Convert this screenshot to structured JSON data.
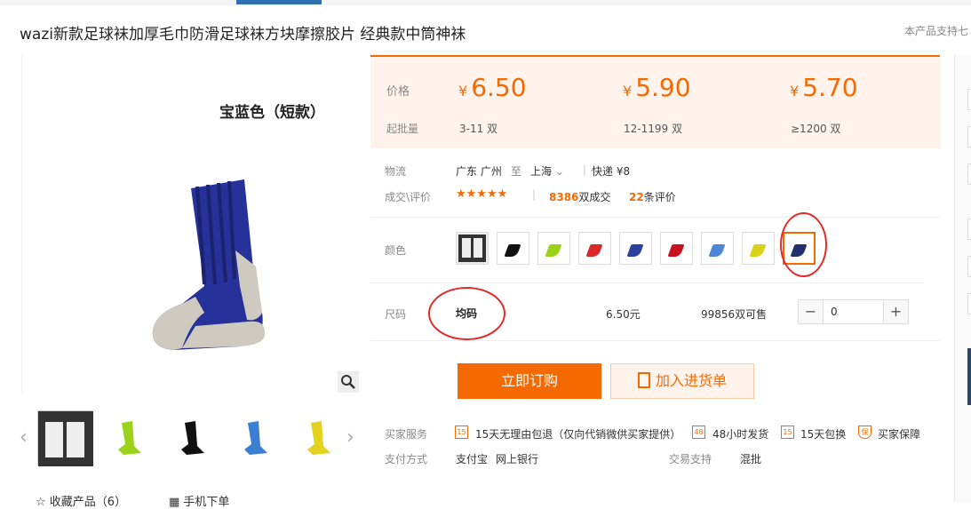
{
  "header": {
    "title": "wazi新款足球袜加厚毛巾防滑足球袜方块摩擦胶片 经典款中筒神袜",
    "support_text": "本产品支持七"
  },
  "gallery": {
    "image_label": "宝蓝色（短款）",
    "prev_icon": "chevron-left-icon",
    "next_icon": "chevron-right-icon",
    "zoom_icon": "magnifier-icon",
    "thumbnails": [
      {
        "colors": [
          "#ffffff",
          "#111111"
        ]
      },
      {
        "colors": [
          "#9bd21a",
          "#e8e8e8"
        ]
      },
      {
        "colors": [
          "#111111",
          "#e8e8e8"
        ]
      },
      {
        "colors": [
          "#3c7fd0",
          "#e8e8e8"
        ]
      },
      {
        "colors": [
          "#e3d21e",
          "#e8e8e8"
        ]
      }
    ],
    "favorite_label": "收藏产品（6）",
    "mobile_label": "手机下单"
  },
  "pricing": {
    "price_label": "价格",
    "batch_label": "起批量",
    "currency": "¥",
    "tiers": [
      {
        "price": "6.50",
        "range": "3-11 双"
      },
      {
        "price": "5.90",
        "range": "12-1199 双"
      },
      {
        "price": "5.70",
        "range": "≥1200 双"
      }
    ]
  },
  "logistics": {
    "label": "物流",
    "from": "广东 广州",
    "to_word": "至",
    "to": "上海",
    "shipping": "快递 ¥8"
  },
  "reviews": {
    "label": "成交\\评价",
    "stars": "★★★★★",
    "deals_count": "8386",
    "deals_suffix": "双成交",
    "review_count": "22",
    "review_suffix": "条评价"
  },
  "color": {
    "label": "颜色",
    "swatches": [
      {
        "color": "#222222"
      },
      {
        "color": "#111111"
      },
      {
        "color": "#9bd21a"
      },
      {
        "color": "#d92a2a"
      },
      {
        "color": "#2b3f9e"
      },
      {
        "color": "#c8111e"
      },
      {
        "color": "#4f86d6"
      },
      {
        "color": "#d8d21a"
      },
      {
        "color": "#23306e"
      }
    ],
    "selected_index": 8
  },
  "size": {
    "label": "尺码",
    "value": "均码",
    "unit_price": "6.50元",
    "stock": "99856双可售",
    "quantity": "0"
  },
  "actions": {
    "buy_label": "立即订购",
    "cart_label": "加入进货单"
  },
  "services": {
    "label": "买家服务",
    "items": [
      {
        "icon": "15",
        "text": "15天无理由包退（仅向代销微供买家提供）"
      },
      {
        "icon": "48",
        "text": "48小时发货"
      },
      {
        "icon": "15",
        "text": "15天包换"
      },
      {
        "icon": "保",
        "text": "买家保障"
      }
    ]
  },
  "payment": {
    "label": "支付方式",
    "methods": [
      "支付宝",
      "网上银行"
    ],
    "support_label": "交易支持",
    "support_value": "混批"
  },
  "colors": {
    "accent": "#f56a00",
    "price_bg": "#fff3eb",
    "highlight": "#e32a2a"
  }
}
